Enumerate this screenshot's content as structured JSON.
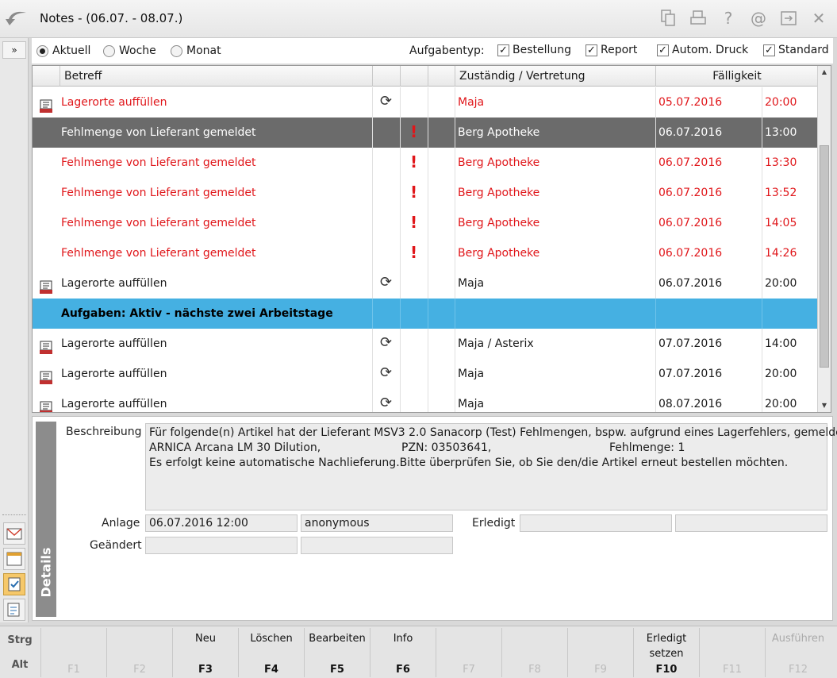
{
  "window": {
    "title": "Notes - (06.07. - 08.07.)",
    "toolbar_icons": [
      "copy-icon",
      "print-icon",
      "help-icon",
      "email-icon",
      "export-icon",
      "close-icon"
    ]
  },
  "filter": {
    "period_options": [
      {
        "label": "Aktuell",
        "selected": true
      },
      {
        "label": "Woche",
        "selected": false
      },
      {
        "label": "Monat",
        "selected": false
      }
    ],
    "task_type_label": "Aufgabentyp:",
    "task_types": [
      {
        "label": "Bestellung",
        "checked": true
      },
      {
        "label": "Report",
        "checked": true
      },
      {
        "label": "Autom. Druck",
        "checked": true
      },
      {
        "label": "Standard",
        "checked": true
      }
    ]
  },
  "grid": {
    "columns": [
      "Betreff",
      "",
      "",
      "",
      "Zuständig / Vertretung",
      "Fälligkeit"
    ],
    "rows": [
      {
        "icon": "task-list-icon",
        "subject": "Lagerorte auffüllen",
        "recurring": true,
        "urgent": false,
        "assignee": "Maja",
        "date": "05.07.2016",
        "time": "20:00",
        "style": "red"
      },
      {
        "icon": "",
        "subject": "Fehlmenge von Lieferant gemeldet",
        "recurring": false,
        "urgent": true,
        "assignee": "Berg Apotheke",
        "date": "06.07.2016",
        "time": "13:00",
        "style": "selected"
      },
      {
        "icon": "",
        "subject": "Fehlmenge von Lieferant gemeldet",
        "recurring": false,
        "urgent": true,
        "assignee": "Berg Apotheke",
        "date": "06.07.2016",
        "time": "13:30",
        "style": "red"
      },
      {
        "icon": "",
        "subject": "Fehlmenge von Lieferant gemeldet",
        "recurring": false,
        "urgent": true,
        "assignee": "Berg Apotheke",
        "date": "06.07.2016",
        "time": "13:52",
        "style": "red"
      },
      {
        "icon": "",
        "subject": "Fehlmenge von Lieferant gemeldet",
        "recurring": false,
        "urgent": true,
        "assignee": "Berg Apotheke",
        "date": "06.07.2016",
        "time": "14:05",
        "style": "red"
      },
      {
        "icon": "",
        "subject": "Fehlmenge von Lieferant gemeldet",
        "recurring": false,
        "urgent": true,
        "assignee": "Berg Apotheke",
        "date": "06.07.2016",
        "time": "14:26",
        "style": "red"
      },
      {
        "icon": "task-list-icon",
        "subject": "Lagerorte auffüllen",
        "recurring": true,
        "urgent": false,
        "assignee": "Maja",
        "date": "06.07.2016",
        "time": "20:00",
        "style": "normal"
      },
      {
        "icon": "",
        "subject": "Aufgaben: Aktiv - nächste zwei Arbeitstage",
        "recurring": false,
        "urgent": false,
        "assignee": "",
        "date": "",
        "time": "",
        "style": "group"
      },
      {
        "icon": "task-list-icon",
        "subject": "Lagerorte auffüllen",
        "recurring": true,
        "urgent": false,
        "assignee": "Maja / Asterix",
        "date": "07.07.2016",
        "time": "14:00",
        "style": "normal"
      },
      {
        "icon": "task-list-icon",
        "subject": "Lagerorte auffüllen",
        "recurring": true,
        "urgent": false,
        "assignee": "Maja",
        "date": "07.07.2016",
        "time": "20:00",
        "style": "normal"
      },
      {
        "icon": "task-list-icon",
        "subject": "Lagerorte auffüllen",
        "recurring": true,
        "urgent": false,
        "assignee": "Maja",
        "date": "08.07.2016",
        "time": "20:00",
        "style": "normal"
      }
    ]
  },
  "details": {
    "tab_label": "Details",
    "description_label": "Beschreibung",
    "description_line1": "Für folgende(n) Artikel hat der Lieferant MSV3 2.0 Sanacorp (Test) Fehlmengen, bspw. aufgrund eines Lagerfehlers, gemeldet:",
    "description_line2_a": "ARNICA Arcana LM 30 Dilution,",
    "description_line2_b": "PZN: 03503641,",
    "description_line2_c": "Fehlmenge: 1",
    "description_line3": "Es erfolgt keine automatische Nachlieferung.Bitte überprüfen Sie, ob Sie den/die Artikel erneut bestellen möchten.",
    "created_label": "Anlage",
    "created_value": "06.07.2016 12:00",
    "created_by": "anonymous",
    "done_label": "Erledigt",
    "done_value": "",
    "done_by": "",
    "changed_label": "Geändert",
    "changed_value": "",
    "changed_by": ""
  },
  "fkeys": {
    "mod1": "Strg",
    "mod2": "Alt",
    "keys": [
      {
        "label": "",
        "key": "F1",
        "enabled": false
      },
      {
        "label": "",
        "key": "F2",
        "enabled": false
      },
      {
        "label": "Neu",
        "key": "F3",
        "enabled": true
      },
      {
        "label": "Löschen",
        "key": "F4",
        "enabled": true
      },
      {
        "label": "Bearbeiten",
        "key": "F5",
        "enabled": true
      },
      {
        "label": "Info",
        "key": "F6",
        "enabled": true
      },
      {
        "label": "",
        "key": "F7",
        "enabled": false
      },
      {
        "label": "",
        "key": "F8",
        "enabled": false
      },
      {
        "label": "",
        "key": "F9",
        "enabled": false
      },
      {
        "label": "Erledigt setzen",
        "key": "F10",
        "enabled": true
      },
      {
        "label": "",
        "key": "F11",
        "enabled": false
      },
      {
        "label": "Ausführen",
        "key": "F12",
        "enabled": false
      }
    ]
  },
  "colors": {
    "overdue_text": "#e0161a",
    "selected_row": "#6b6b6b",
    "group_row": "#45b0e2"
  }
}
